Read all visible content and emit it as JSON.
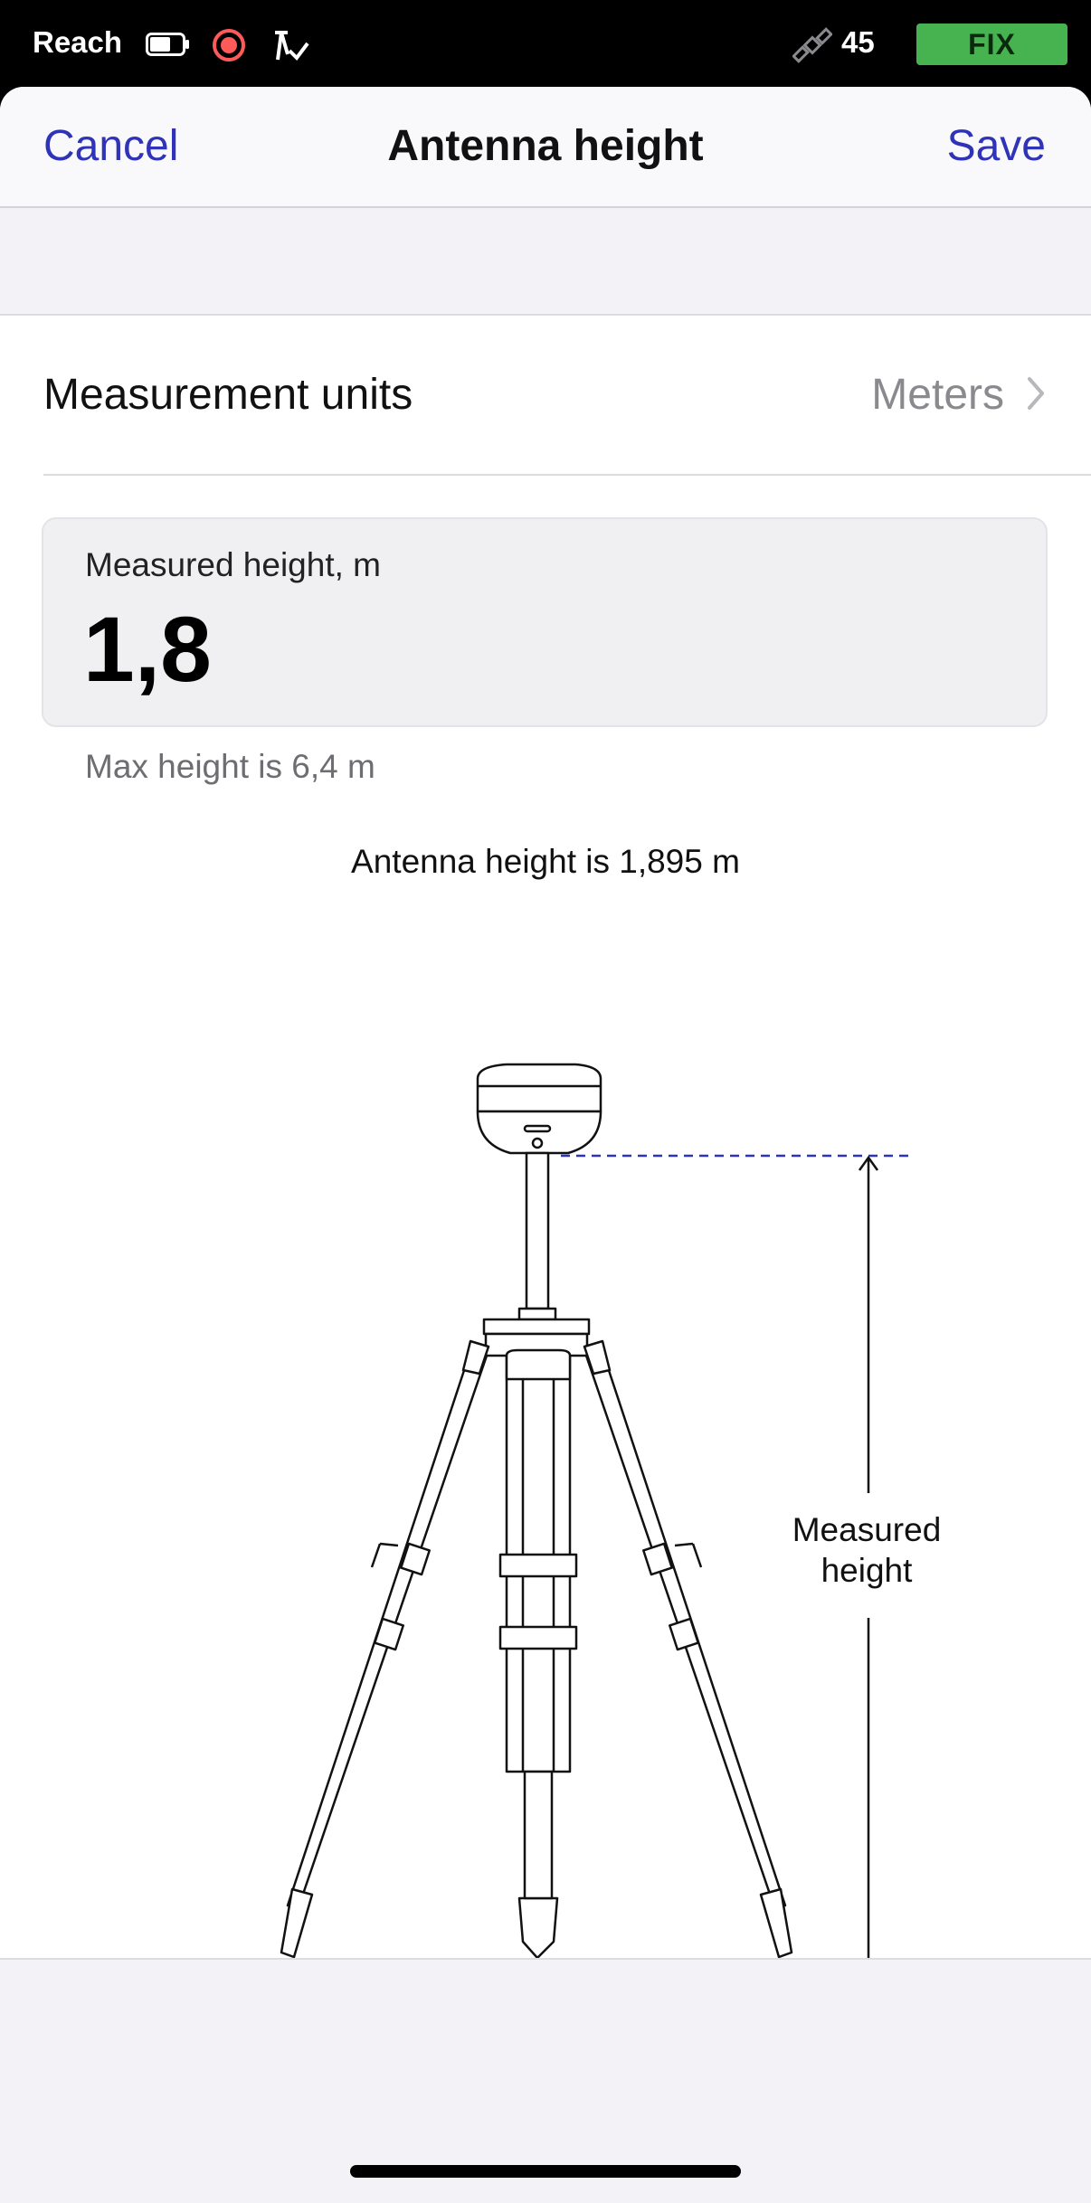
{
  "status_bar": {
    "app_name": "Reach",
    "satellite_count": "45",
    "fix_status": "FIX",
    "fix_color": "#47b350",
    "icons": [
      "battery-icon",
      "record-icon",
      "survey-tool-icon",
      "satellite-icon"
    ]
  },
  "nav": {
    "cancel_label": "Cancel",
    "title": "Antenna height",
    "save_label": "Save",
    "accent_color": "#2f33b7"
  },
  "settings": {
    "units_label": "Measurement units",
    "units_value": "Meters"
  },
  "height_field": {
    "label": "Measured height, m",
    "value": "1,8",
    "hint": "Max height is 6,4 m"
  },
  "antenna_height_text": "Antenna height is 1,895 m",
  "diagram": {
    "label_line1": "Measured",
    "label_line2": "height"
  }
}
